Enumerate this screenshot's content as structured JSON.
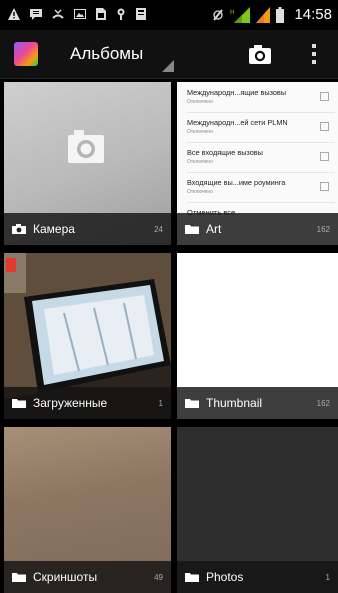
{
  "status_bar": {
    "time": "14:58",
    "left_icons": [
      "warning-icon",
      "message-icon",
      "missed-call-icon",
      "image-icon",
      "sim-icon",
      "usb-icon",
      "storage-icon"
    ],
    "right_icons": [
      "alarm-icon",
      "signal-icon",
      "signal-icon",
      "battery-icon"
    ]
  },
  "action_bar": {
    "title": "Альбомы",
    "icons": [
      "gallery-app-icon",
      "camera-icon",
      "overflow-menu-icon"
    ]
  },
  "settings_panel": {
    "rows": [
      {
        "title": "Международн...ящие вызовы",
        "subtitle": "Отключено"
      },
      {
        "title": "Международн...ей сети PLMN",
        "subtitle": "Отключено"
      },
      {
        "title": "Все входящие вызовы",
        "subtitle": "Отключено"
      },
      {
        "title": "Входящие вы...име роуминга",
        "subtitle": "Отключено"
      }
    ],
    "cancel_label": "Отменить все"
  },
  "albums": [
    {
      "name": "Камера",
      "count": "24",
      "icon": "camera-icon"
    },
    {
      "name": "Art",
      "count": "162",
      "icon": "folder-icon"
    },
    {
      "name": "Загруженные",
      "count": "1",
      "icon": "folder-icon"
    },
    {
      "name": "Thumbnail",
      "count": "162",
      "icon": "folder-icon"
    },
    {
      "name": "Скриншоты",
      "count": "49",
      "icon": "folder-icon"
    },
    {
      "name": "Photos",
      "count": "1",
      "icon": "folder-icon"
    }
  ],
  "colors": {
    "background": "#000000",
    "action_bar": "#111111",
    "label_overlay": "#141414",
    "signal_green": "#7ec61a",
    "signal_orange": "#f39c12"
  }
}
